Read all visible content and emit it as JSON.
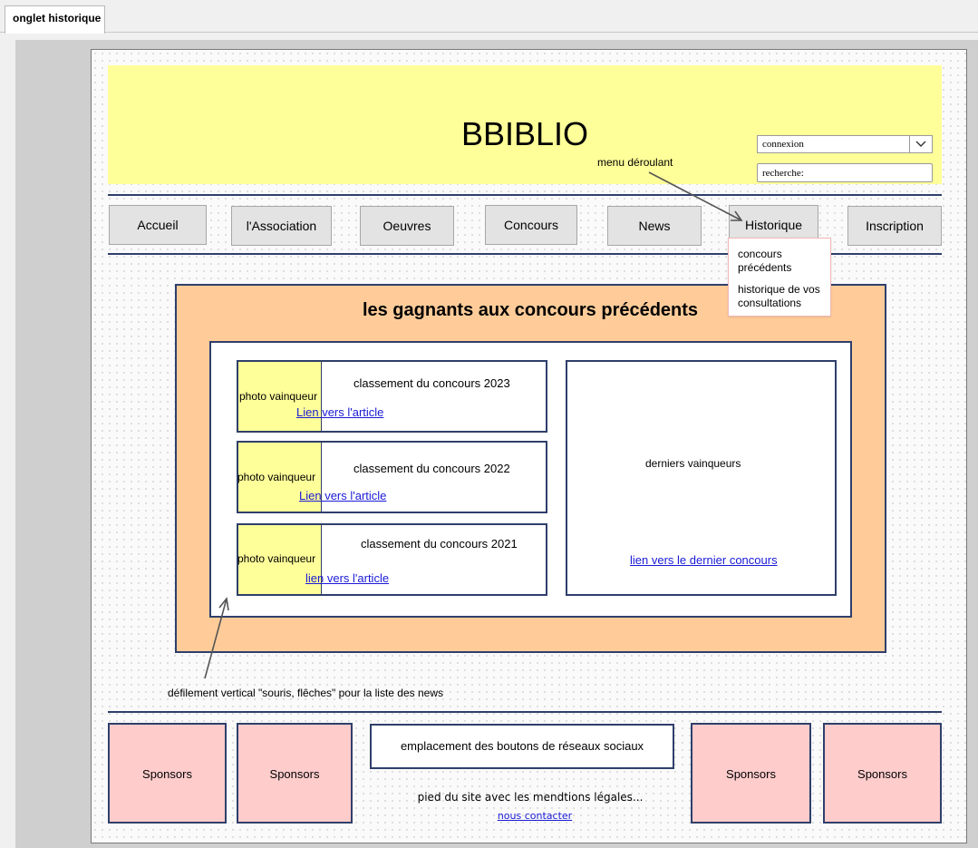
{
  "tab": {
    "label": "onglet historique"
  },
  "header": {
    "title": "BBIBLIO",
    "connexion": "connexion",
    "search_placeholder": "recherche:"
  },
  "annotations": {
    "menu_note": "menu déroulant",
    "scroll_note": "défilement vertical \"souris, flêches\" pour la liste des news"
  },
  "nav": {
    "items": [
      "Accueil",
      "l'Association",
      "Oeuvres",
      "Concours",
      "News",
      "Historique",
      "Inscription"
    ]
  },
  "dropdown": {
    "items": [
      "concours précédents",
      "historique de vos consultations"
    ]
  },
  "main": {
    "title": "les gagnants aux concours précédents",
    "cards": [
      {
        "photo": "photo vainqueur",
        "title": "classement du concours 2023",
        "link": "Lien vers l'article"
      },
      {
        "photo": "photo vainqueur",
        "title": "classement du concours 2022",
        "link": "Lien vers l'article"
      },
      {
        "photo": "photo vainqueur",
        "title": "classement du concours 2021",
        "link": "lien vers l'article"
      }
    ],
    "winners_label": "derniers vainqueurs",
    "winners_link": "lien vers le dernier concours"
  },
  "footer": {
    "sponsors": [
      "Sponsors",
      "Sponsors",
      "Sponsors",
      "Sponsors"
    ],
    "social": "emplacement des boutons de réseaux sociaux",
    "legal": "pied du site avec les mendtions légales...",
    "contact": "nous contacter"
  },
  "colors": {
    "header_bg": "#ffff99",
    "main_bg": "#ffcc99",
    "sponsor_bg": "#ffcccc",
    "border": "#2f3f6b",
    "link": "#1a1ad6"
  }
}
